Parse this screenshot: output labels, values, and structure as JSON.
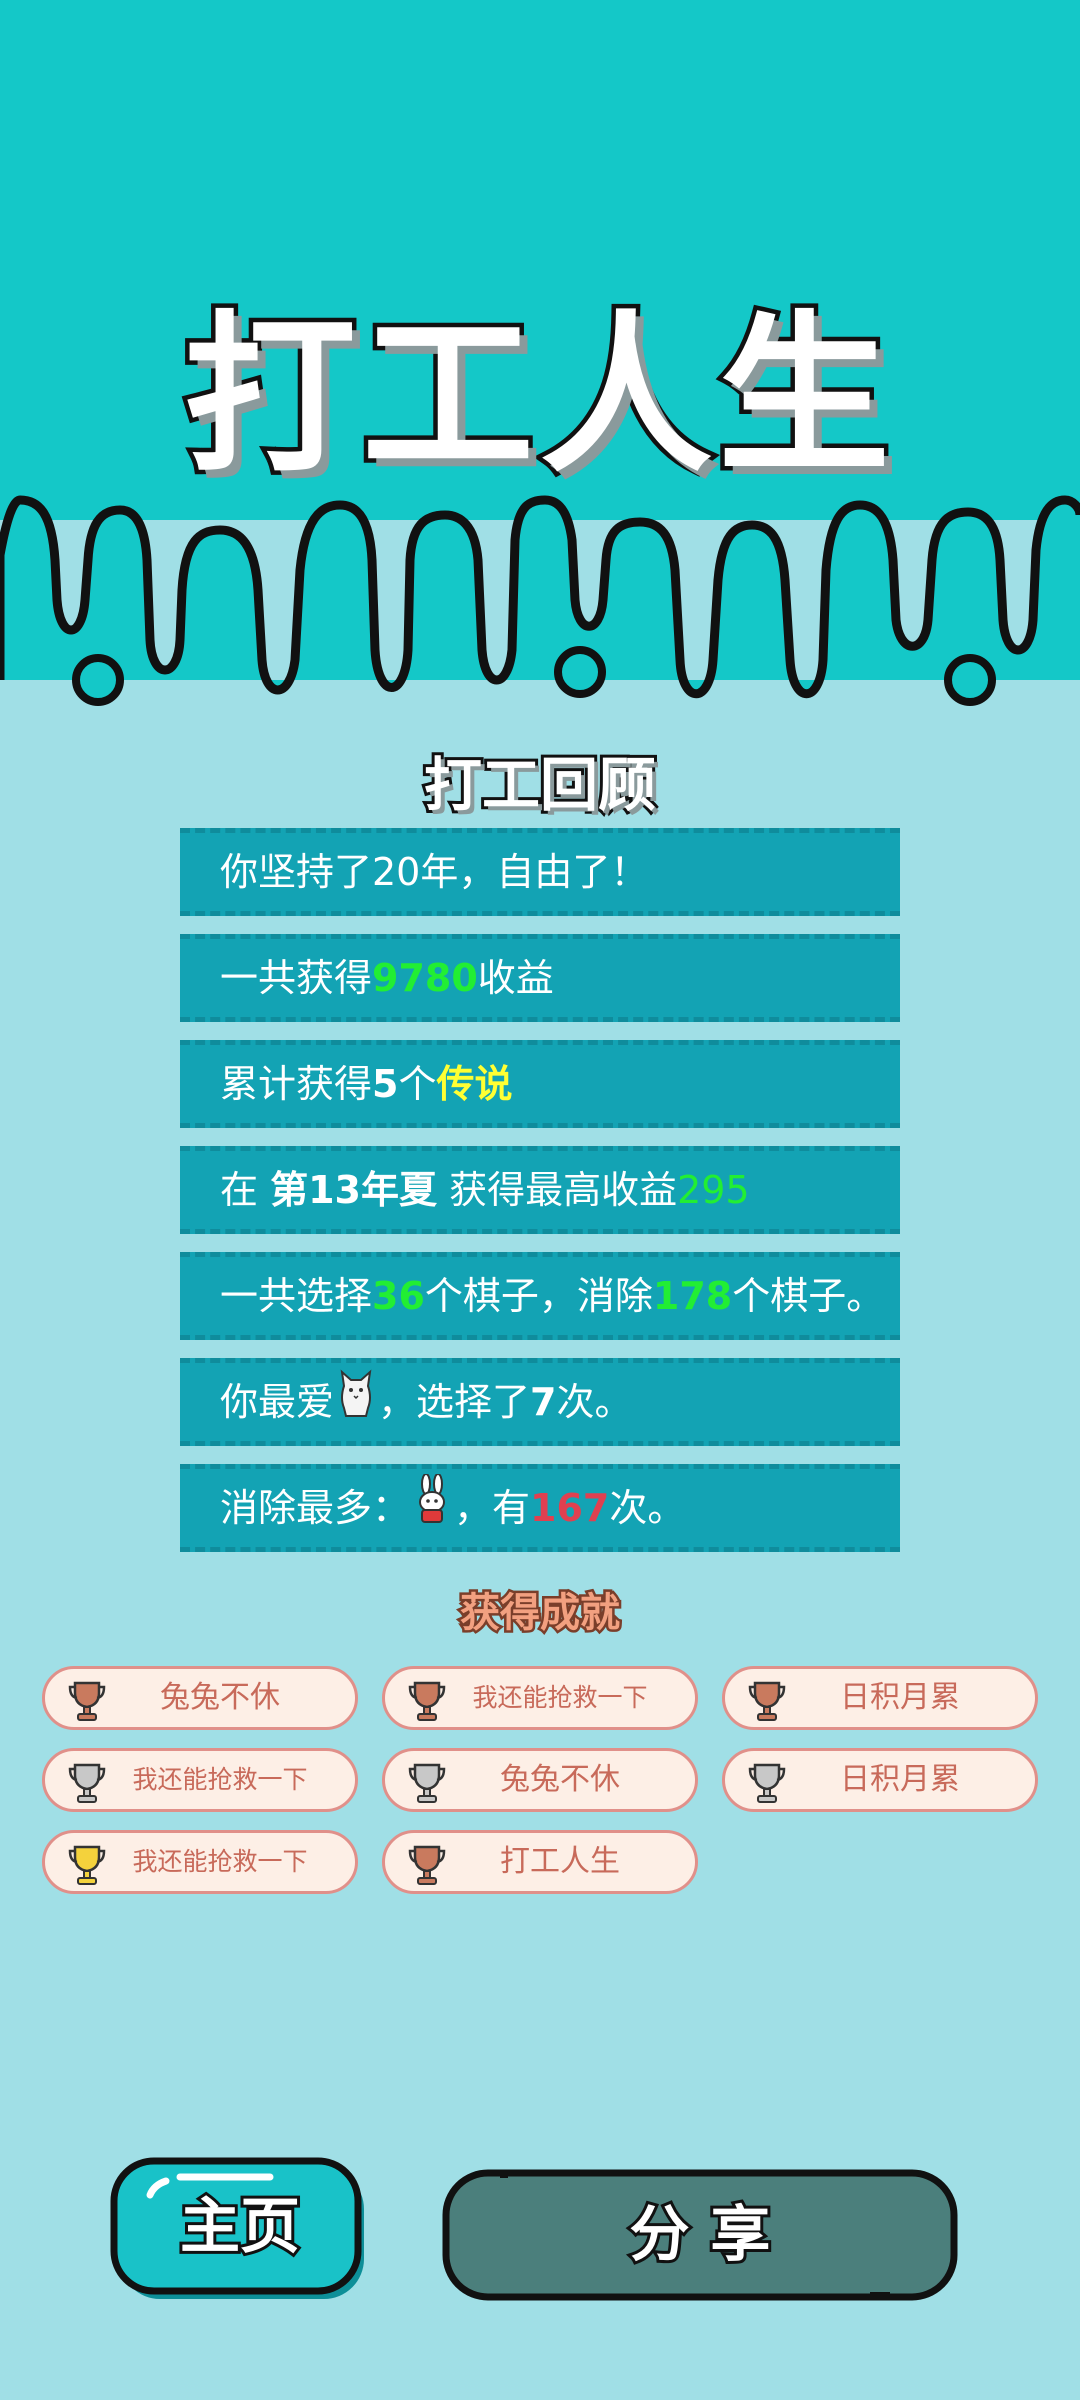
{
  "title": "打工人生",
  "review": {
    "heading": "打工回顾",
    "line1": {
      "text": "你坚持了20年，自由了！"
    },
    "line2": {
      "pre": "一共获得",
      "value": "9780",
      "post": "收益"
    },
    "line3": {
      "pre": "累计获得",
      "count": "5",
      "mid": "个",
      "tier": "传说"
    },
    "line4": {
      "pre": "在 ",
      "season": "第13年夏",
      "mid": " 获得最高收益",
      "value": "295"
    },
    "line5": {
      "pre": "一共选择",
      "chosen": "36",
      "mid": "个棋子，消除",
      "removed": "178",
      "post": "个棋子。"
    },
    "line6": {
      "pre": "你最爱",
      "icon": "cat-icon",
      "mid": "，选择了",
      "count": "7",
      "post": "次。"
    },
    "line7": {
      "pre": "消除最多：",
      "icon": "rabbit-icon",
      "mid": "，有",
      "count": "167",
      "post": "次。"
    }
  },
  "achievements": {
    "heading": "获得成就",
    "items": [
      {
        "label": "兔兔不休",
        "trophy": "bronze"
      },
      {
        "label": "我还能抢救一下",
        "trophy": "bronze"
      },
      {
        "label": "日积月累",
        "trophy": "bronze"
      },
      {
        "label": "我还能抢救一下",
        "trophy": "silver"
      },
      {
        "label": "兔兔不休",
        "trophy": "silver"
      },
      {
        "label": "日积月累",
        "trophy": "silver"
      },
      {
        "label": "我还能抢救一下",
        "trophy": "gold"
      },
      {
        "label": "打工人生",
        "trophy": "bronze"
      }
    ]
  },
  "buttons": {
    "home": "主页",
    "share": "分 享"
  },
  "colors": {
    "header": "#14c8c8",
    "background": "#a0dfe6",
    "row": "#13a3b4",
    "highlight_green": "#22ee33",
    "highlight_yellow": "#ffff33",
    "highlight_red": "#e04050",
    "home_button": "#19c2c8",
    "share_button": "#4b7f7c",
    "bronze": "#c97a5e",
    "silver": "#c8c8c8",
    "gold": "#f4d23c"
  }
}
